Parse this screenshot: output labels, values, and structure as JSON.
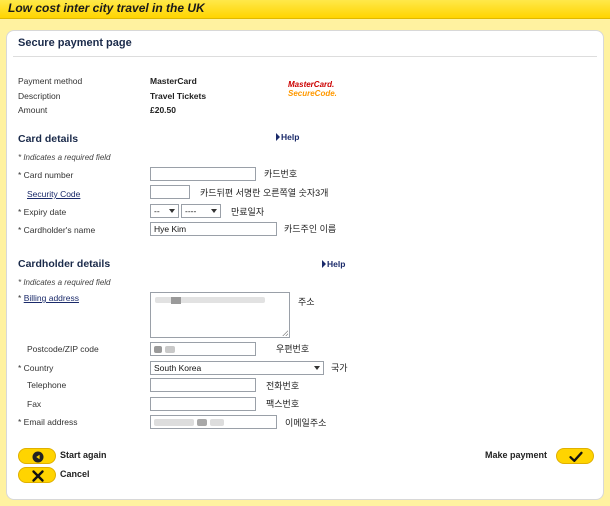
{
  "header": {
    "tagline": "Low cost inter city travel in the UK",
    "colors": {
      "brand": "#ffd400",
      "text": "#1a2a4a"
    }
  },
  "page": {
    "title": "Secure payment page"
  },
  "payment_info": {
    "method_label": "Payment method",
    "method_value": "MasterCard",
    "description_label": "Description",
    "description_value": "Travel Tickets",
    "amount_label": "Amount",
    "amount_value": "£20.50",
    "logo_line1": "MasterCard.",
    "logo_line2": "SecureCode."
  },
  "card_details": {
    "heading": "Card details",
    "help": "Help",
    "required_note": "* Indicates a required field",
    "card_number_label": "* Card number",
    "card_number_value": "",
    "card_number_kr": "카드번호",
    "security_code_label": "Security Code",
    "security_code_value": "",
    "security_code_kr": "카드뒤편 서명란 오른쪽열 숫자3개",
    "expiry_label": "* Expiry date",
    "expiry_month": "--",
    "expiry_year": "----",
    "expiry_kr": "만료일자",
    "holder_label": "* Cardholder's name",
    "holder_value": "Hye Kim",
    "holder_kr": "카드주인 이름"
  },
  "cardholder_details": {
    "heading": "Cardholder details",
    "help": "Help",
    "required_note": "* Indicates a required field",
    "billing_star": "*",
    "billing_label": "Billing address",
    "billing_kr": "주소",
    "postcode_label": "Postcode/ZIP code",
    "postcode_kr": "우편번호",
    "country_label": "* Country",
    "country_value": "South Korea",
    "country_kr": "국가",
    "telephone_label": "Telephone",
    "telephone_value": "",
    "telephone_kr": "전화번호",
    "fax_label": "Fax",
    "fax_value": "",
    "fax_kr": "팩스번호",
    "email_label": "* Email address",
    "email_kr": "이메일주소"
  },
  "actions": {
    "start_again": "Start again",
    "cancel": "Cancel",
    "make_payment": "Make payment"
  }
}
